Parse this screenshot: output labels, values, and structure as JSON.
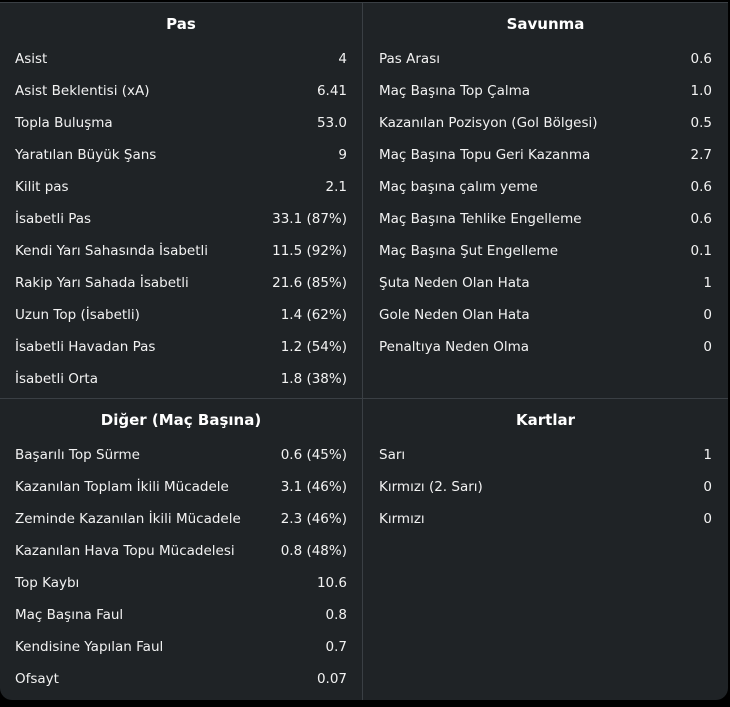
{
  "sections": {
    "pas": {
      "title": "Pas",
      "rows": [
        {
          "label": "Asist",
          "value": "4"
        },
        {
          "label": "Asist Beklentisi (xA)",
          "value": "6.41"
        },
        {
          "label": "Topla Buluşma",
          "value": "53.0"
        },
        {
          "label": "Yaratılan Büyük Şans",
          "value": "9"
        },
        {
          "label": "Kilit pas",
          "value": "2.1"
        },
        {
          "label": "İsabetli Pas",
          "value": "33.1 (87%)"
        },
        {
          "label": "Kendi Yarı Sahasında İsabetli",
          "value": "11.5 (92%)"
        },
        {
          "label": "Rakip Yarı Sahada İsabetli",
          "value": "21.6 (85%)"
        },
        {
          "label": "Uzun Top (İsabetli)",
          "value": "1.4 (62%)"
        },
        {
          "label": "İsabetli Havadan Pas",
          "value": "1.2 (54%)"
        },
        {
          "label": "İsabetli Orta",
          "value": "1.8 (38%)"
        }
      ]
    },
    "savunma": {
      "title": "Savunma",
      "rows": [
        {
          "label": "Pas Arası",
          "value": "0.6"
        },
        {
          "label": "Maç Başına Top Çalma",
          "value": "1.0"
        },
        {
          "label": "Kazanılan Pozisyon (Gol Bölgesi)",
          "value": "0.5"
        },
        {
          "label": "Maç Başına Topu Geri Kazanma",
          "value": "2.7"
        },
        {
          "label": "Maç başına çalım yeme",
          "value": "0.6"
        },
        {
          "label": "Maç Başına Tehlike Engelleme",
          "value": "0.6"
        },
        {
          "label": "Maç Başına Şut Engelleme",
          "value": "0.1"
        },
        {
          "label": "Şuta Neden Olan Hata",
          "value": "1"
        },
        {
          "label": "Gole Neden Olan Hata",
          "value": "0"
        },
        {
          "label": "Penaltıya Neden Olma",
          "value": "0"
        }
      ]
    },
    "diger": {
      "title": "Diğer (Maç Başına)",
      "rows": [
        {
          "label": "Başarılı Top Sürme",
          "value": "0.6 (45%)"
        },
        {
          "label": "Kazanılan Toplam İkili Mücadele",
          "value": "3.1 (46%)"
        },
        {
          "label": "Zeminde Kazanılan İkili Mücadele",
          "value": "2.3 (46%)"
        },
        {
          "label": "Kazanılan Hava Topu Mücadelesi",
          "value": "0.8 (48%)"
        },
        {
          "label": "Top Kaybı",
          "value": "10.6"
        },
        {
          "label": "Maç Başına Faul",
          "value": "0.8"
        },
        {
          "label": "Kendisine Yapılan Faul",
          "value": "0.7"
        },
        {
          "label": "Ofsayt",
          "value": "0.07"
        }
      ]
    },
    "kartlar": {
      "title": "Kartlar",
      "rows": [
        {
          "label": "Sarı",
          "value": "1"
        },
        {
          "label": "Kırmızı (2. Sarı)",
          "value": "0"
        },
        {
          "label": "Kırmızı",
          "value": "0"
        }
      ]
    }
  },
  "colors": {
    "background": "#1f2326",
    "divider": "#3a3f44",
    "text": "#ffffff"
  }
}
